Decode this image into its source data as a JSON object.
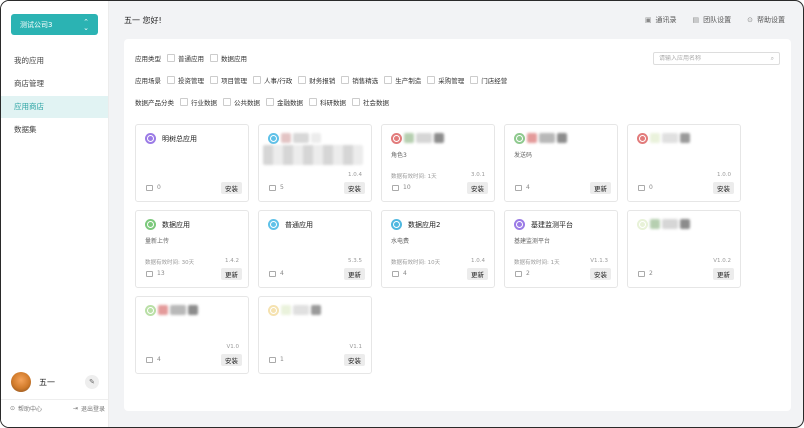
{
  "sidebar": {
    "company": "测试公司3",
    "items": [
      {
        "label": "我的应用",
        "active": false
      },
      {
        "label": "商店管理",
        "active": false
      },
      {
        "label": "应用商店",
        "active": true
      },
      {
        "label": "数据集",
        "active": false
      }
    ],
    "user_name": "五一",
    "help": "帮助中心",
    "logout": "退出登录"
  },
  "header": {
    "greeting": "五一 您好!",
    "links": [
      "通讯录",
      "团队设置",
      "帮助设置"
    ]
  },
  "filters": {
    "type": {
      "title": "应用类型",
      "options": [
        "普通应用",
        "数据应用"
      ]
    },
    "scene": {
      "title": "应用场景",
      "options": [
        "投资管理",
        "项目管理",
        "人事/行政",
        "财务报销",
        "销售精选",
        "生产制造",
        "采购管理",
        "门店经营"
      ]
    },
    "data_category": {
      "title": "数据产品分类",
      "options": [
        "行业数据",
        "公共数据",
        "金融数据",
        "科研数据",
        "社会数据"
      ]
    },
    "search_placeholder": "请输入应用名称"
  },
  "accent_color": "#2bb3b3",
  "cards": [
    {
      "name": "明树总应用",
      "desc": "",
      "valid": "",
      "version": "",
      "count": "0",
      "button": "安装",
      "icon_color": "#9b7be6",
      "blurred": false
    },
    {
      "name": "",
      "desc": "",
      "valid": "",
      "version": "1.0.4",
      "count": "5",
      "button": "安装",
      "icon_color": "#5fc1e8",
      "blurred": true
    },
    {
      "name": "",
      "desc": "角色3",
      "valid": "数据有效时间: 1天",
      "version": "3.0.1",
      "count": "10",
      "button": "安装",
      "icon_color": "#e27b7b",
      "blurred": true
    },
    {
      "name": "",
      "desc": "发送码",
      "valid": "",
      "version": "",
      "count": "4",
      "button": "更新",
      "icon_color": "#8ec98e",
      "blurred": true
    },
    {
      "name": "",
      "desc": "",
      "valid": "",
      "version": "1.0.0",
      "count": "0",
      "button": "安装",
      "icon_color": "#e27b7b",
      "blurred": true
    },
    {
      "name": "数据应用",
      "desc": "量新上传",
      "valid": "数据有效时间: 30天",
      "version": "1.4.2",
      "count": "13",
      "button": "更新",
      "icon_color": "#7cc97c",
      "blurred": false
    },
    {
      "name": "普通应用",
      "desc": "",
      "valid": "",
      "version": "5.3.5",
      "count": "4",
      "button": "更新",
      "icon_color": "#5fc1e8",
      "blurred": false
    },
    {
      "name": "数据应用2",
      "desc": "水电费",
      "valid": "数据有效时间: 10天",
      "version": "1.0.4",
      "count": "4",
      "button": "更新",
      "icon_color": "#4fb8e0",
      "blurred": false
    },
    {
      "name": "基建监测平台",
      "desc": "基建监测平台",
      "valid": "数据有效时间: 1天",
      "version": "V1.1.3",
      "count": "2",
      "button": "安装",
      "icon_color": "#9b7be6",
      "blurred": false
    },
    {
      "name": "",
      "desc": "",
      "valid": "",
      "version": "V1.0.2",
      "count": "2",
      "button": "更新",
      "icon_color": "#e8f2d8",
      "blurred": true
    },
    {
      "name": "",
      "desc": "",
      "valid": "",
      "version": "V1.0",
      "count": "4",
      "button": "安装",
      "icon_color": "#b9dfa6",
      "blurred": true
    },
    {
      "name": "",
      "desc": "",
      "valid": "",
      "version": "V1.1",
      "count": "1",
      "button": "安装",
      "icon_color": "#f5e2b0",
      "blurred": true
    }
  ]
}
